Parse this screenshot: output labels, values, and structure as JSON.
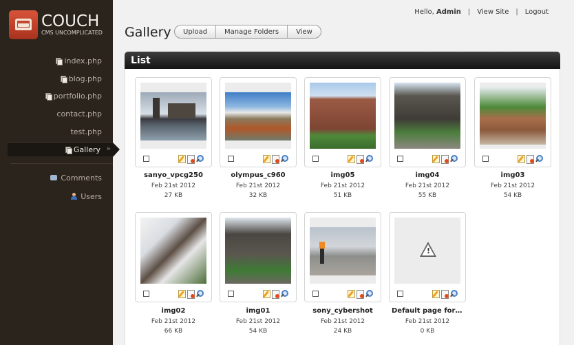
{
  "brand": {
    "title": "COUCH",
    "subtitle": "CMS UNCOMPLICATED"
  },
  "sidebar": {
    "items": [
      {
        "label": "index.php",
        "icon": "page-icon"
      },
      {
        "label": "blog.php",
        "icon": "page-icon"
      },
      {
        "label": "portfolio.php",
        "icon": "page-icon"
      },
      {
        "label": "contact.php",
        "icon": "none"
      },
      {
        "label": "test.php",
        "icon": "none"
      },
      {
        "label": "Gallery",
        "icon": "page-icon",
        "active": true
      },
      {
        "label": "Comments",
        "icon": "comments-icon"
      },
      {
        "label": "Users",
        "icon": "users-icon"
      }
    ],
    "active_chevron": "»"
  },
  "topbar": {
    "greeting": "Hello,",
    "user": "Admin",
    "view_site": "View Site",
    "logout": "Logout",
    "separator": "|"
  },
  "page": {
    "title": "Gallery",
    "buttons": [
      "Upload",
      "Manage Folders",
      "View"
    ]
  },
  "list": {
    "heading": "List",
    "items": [
      {
        "name": "sanyo_vpcg250",
        "date": "Feb 21st 2012",
        "size": "27 KB",
        "thumb": "harbor"
      },
      {
        "name": "olympus_c960",
        "date": "Feb 21st 2012",
        "size": "32 KB",
        "thumb": "mountain"
      },
      {
        "name": "img05",
        "date": "Feb 21st 2012",
        "size": "51 KB",
        "thumb": "brick-house"
      },
      {
        "name": "img04",
        "date": "Feb 21st 2012",
        "size": "55 KB",
        "thumb": "stairs-house"
      },
      {
        "name": "img03",
        "date": "Feb 21st 2012",
        "size": "54 KB",
        "thumb": "deck"
      },
      {
        "name": "img02",
        "date": "Feb 21st 2012",
        "size": "66 KB",
        "thumb": "blossom-house"
      },
      {
        "name": "img01",
        "date": "Feb 21st 2012",
        "size": "54 KB",
        "thumb": "porch-house"
      },
      {
        "name": "sony_cybershot",
        "date": "Feb 21st 2012",
        "size": "24 KB",
        "thumb": "beach-person"
      },
      {
        "name": "Default page for gal...",
        "date": "Feb 21st 2012",
        "size": "0 KB",
        "thumb": "warning-icon"
      }
    ]
  },
  "colors": {
    "sidebar": "#2b241d",
    "accent": "#c0412a",
    "header": "#1f1f1f"
  }
}
